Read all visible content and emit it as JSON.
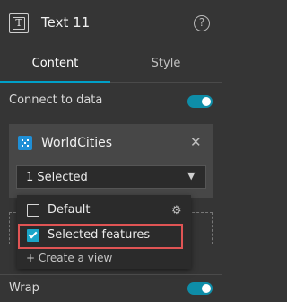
{
  "header": {
    "title": "Text 11",
    "text_icon_glyph": "T",
    "help_glyph": "?"
  },
  "tabs": [
    {
      "label": "Content",
      "active": true
    },
    {
      "label": "Style",
      "active": false
    }
  ],
  "connect": {
    "label": "Connect to data",
    "enabled": true
  },
  "data_source": {
    "name": "WorldCities",
    "close_glyph": "✕",
    "selection_value": "1 Selected",
    "caret_glyph": "▼"
  },
  "dropdown": {
    "options": [
      {
        "label": "Default",
        "checked": false,
        "gear_glyph": "⚙"
      },
      {
        "label": "Selected features",
        "checked": true
      }
    ],
    "create_link": "+ Create a view"
  },
  "wrap": {
    "label": "Wrap",
    "enabled": true
  },
  "colors": {
    "accent": "#1aa5c8",
    "panel": "#353535",
    "card": "#474747",
    "highlight": "#e05454"
  }
}
